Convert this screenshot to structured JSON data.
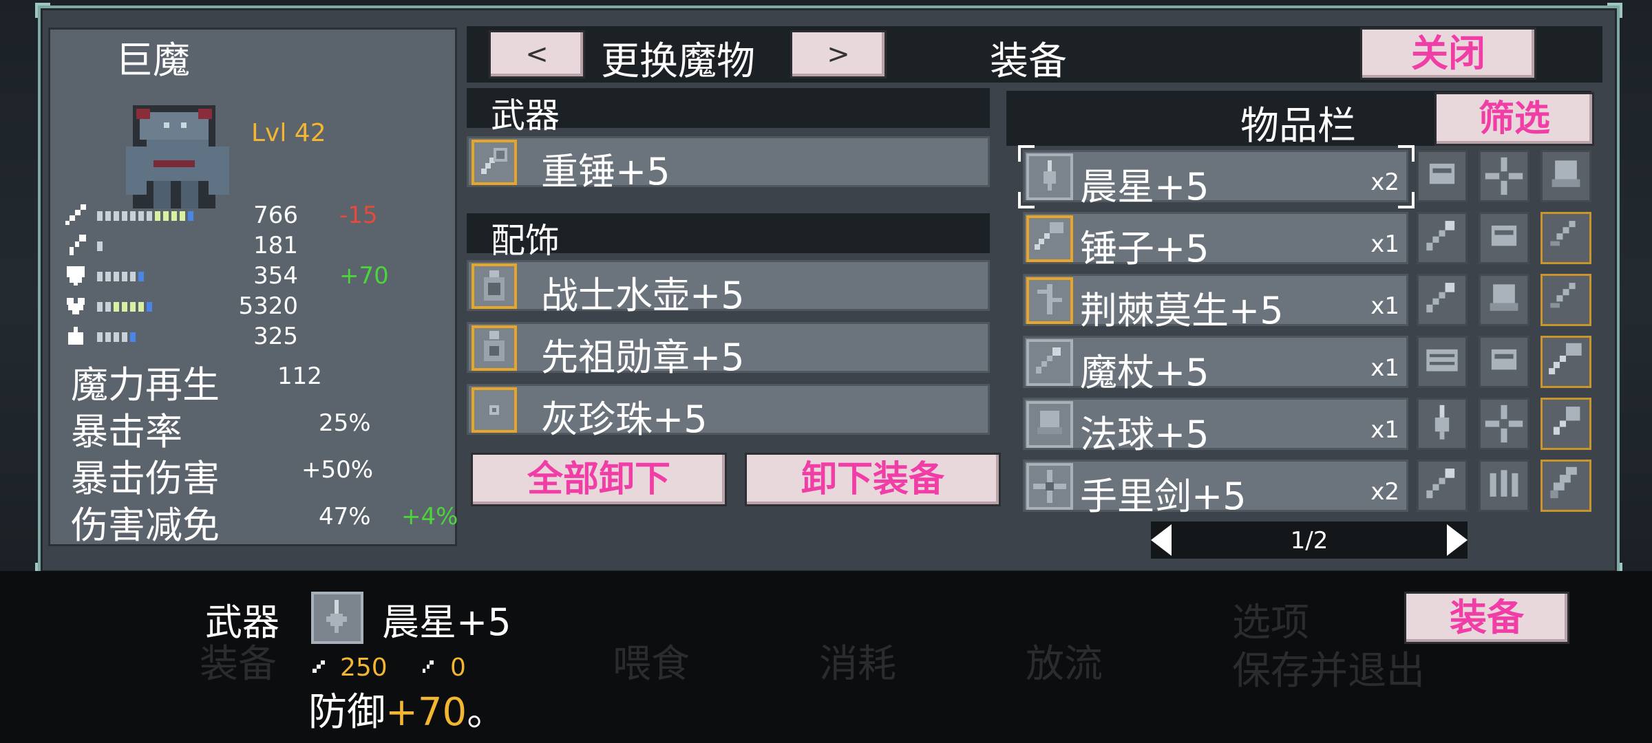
{
  "monster": {
    "name": "巨魔",
    "level": "Lvl 42",
    "stats": [
      {
        "icon": "sword-icon",
        "value": "766",
        "delta": "-15",
        "delta_type": "neg",
        "bar_fraction": 0.95
      },
      {
        "icon": "wand-icon",
        "value": "181",
        "delta": "",
        "delta_type": "",
        "bar_fraction": 0.07
      },
      {
        "icon": "shield-icon",
        "value": "354",
        "delta": "+70",
        "delta_type": "pos",
        "bar_fraction": 0.45
      },
      {
        "icon": "heart-icon",
        "value": "5320",
        "delta": "",
        "delta_type": "",
        "bar_fraction": 0.55
      },
      {
        "icon": "potion-icon",
        "value": "325",
        "delta": "",
        "delta_type": "",
        "bar_fraction": 0.35
      }
    ],
    "text_stats": [
      {
        "label": "魔力再生",
        "value": "112",
        "delta": ""
      },
      {
        "label": "暴击率",
        "value": "25%",
        "delta": ""
      },
      {
        "label": "暴击伤害",
        "value": "+50%",
        "delta": ""
      },
      {
        "label": "伤害减免",
        "value": "47%",
        "delta": "+4%"
      }
    ]
  },
  "header": {
    "prev_label": "<",
    "switch_label": "更换魔物",
    "next_label": ">",
    "title": "装备",
    "close_label": "关闭"
  },
  "equipment": {
    "weapon_section": "武器",
    "weapon": {
      "label": "重锤+5",
      "icon": "mace-icon"
    },
    "accessory_section": "配饰",
    "accessories": [
      {
        "label": "战士水壶+5",
        "icon": "flask-icon"
      },
      {
        "label": "先祖勋章+5",
        "icon": "medal-icon"
      },
      {
        "label": "灰珍珠+5",
        "icon": "pearl-icon"
      }
    ],
    "unequip_all_label": "全部卸下",
    "unequip_label": "卸下装备"
  },
  "inventory": {
    "title": "物品栏",
    "filter_label": "筛选",
    "items": [
      {
        "label": "晨星+5",
        "count": "x2",
        "icon": "morningstar-icon",
        "gold": false,
        "selected": true
      },
      {
        "label": "锤子+5",
        "count": "x1",
        "icon": "hammer-icon",
        "gold": true,
        "selected": false
      },
      {
        "label": "荆棘莫生+5",
        "count": "x1",
        "icon": "thorn-icon",
        "gold": true,
        "selected": false
      },
      {
        "label": "魔杖+5",
        "count": "x1",
        "icon": "wand-icon",
        "gold": false,
        "selected": false
      },
      {
        "label": "法球+5",
        "count": "x1",
        "icon": "orb-icon",
        "gold": false,
        "selected": false
      },
      {
        "label": "手里剑+5",
        "count": "x2",
        "icon": "shuriken-icon",
        "gold": false,
        "selected": false
      }
    ],
    "grid": [
      [
        "glove-icon",
        "shuriken-icon",
        "orb-icon"
      ],
      [
        "wand-icon",
        "glove-icon",
        "dagger-icon"
      ],
      [
        "wand-icon",
        "orb-icon",
        "dagger-icon"
      ],
      [
        "gauntlet-icon",
        "glove-icon",
        "hammer-icon"
      ],
      [
        "morningstar-icon",
        "shuriken-icon",
        "mace-icon"
      ],
      [
        "wand-icon",
        "claw-icon",
        "blade-icon"
      ]
    ],
    "grid_gold": [
      [
        false,
        false,
        false
      ],
      [
        false,
        false,
        true
      ],
      [
        false,
        false,
        true
      ],
      [
        false,
        false,
        true
      ],
      [
        false,
        false,
        true
      ],
      [
        false,
        false,
        true
      ]
    ],
    "page": "1/2"
  },
  "detail": {
    "category": "武器",
    "item_name": "晨星+5",
    "attack": "250",
    "magic": "0",
    "description_prefix": "防御",
    "description_value": "+70",
    "description_suffix": "。",
    "equip_label": "装备"
  },
  "background_text": [
    "装备",
    "喂食",
    "消耗",
    "放流",
    "选项",
    "保存并退出"
  ],
  "colors": {
    "accent_pink": "#f03ea6",
    "gold": "#f2b632",
    "positive": "#4cd43a",
    "negative": "#e84a3a",
    "frame_teal": "#7fa8a4"
  }
}
